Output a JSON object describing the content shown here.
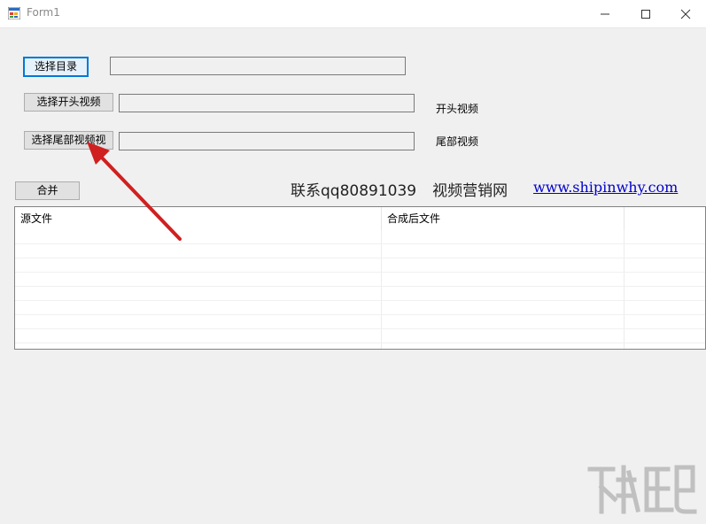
{
  "window": {
    "title": "Form1"
  },
  "controls": {
    "select_dir_button": "选择目录",
    "select_intro_button": "选择开头视频",
    "select_outro_button": "选择尾部视频视",
    "merge_button": "合并",
    "dir_path_value": "",
    "intro_path_value": "",
    "outro_path_value": "",
    "intro_label": "开头视频",
    "outro_label": "尾部视频"
  },
  "contact": {
    "qq": "联系qq80891039",
    "brand": "视频营销网",
    "link": "www.shipinwhy.com"
  },
  "grid": {
    "columns": [
      "源文件",
      "合成后文件",
      ""
    ],
    "rows": []
  },
  "colors": {
    "focus_border": "#0078d7",
    "link": "#0000cc",
    "annotation_arrow": "#d02020"
  },
  "icons": {
    "app": "form-app-icon",
    "minimize": "minimize-icon",
    "maximize": "maximize-icon",
    "close": "close-icon"
  }
}
